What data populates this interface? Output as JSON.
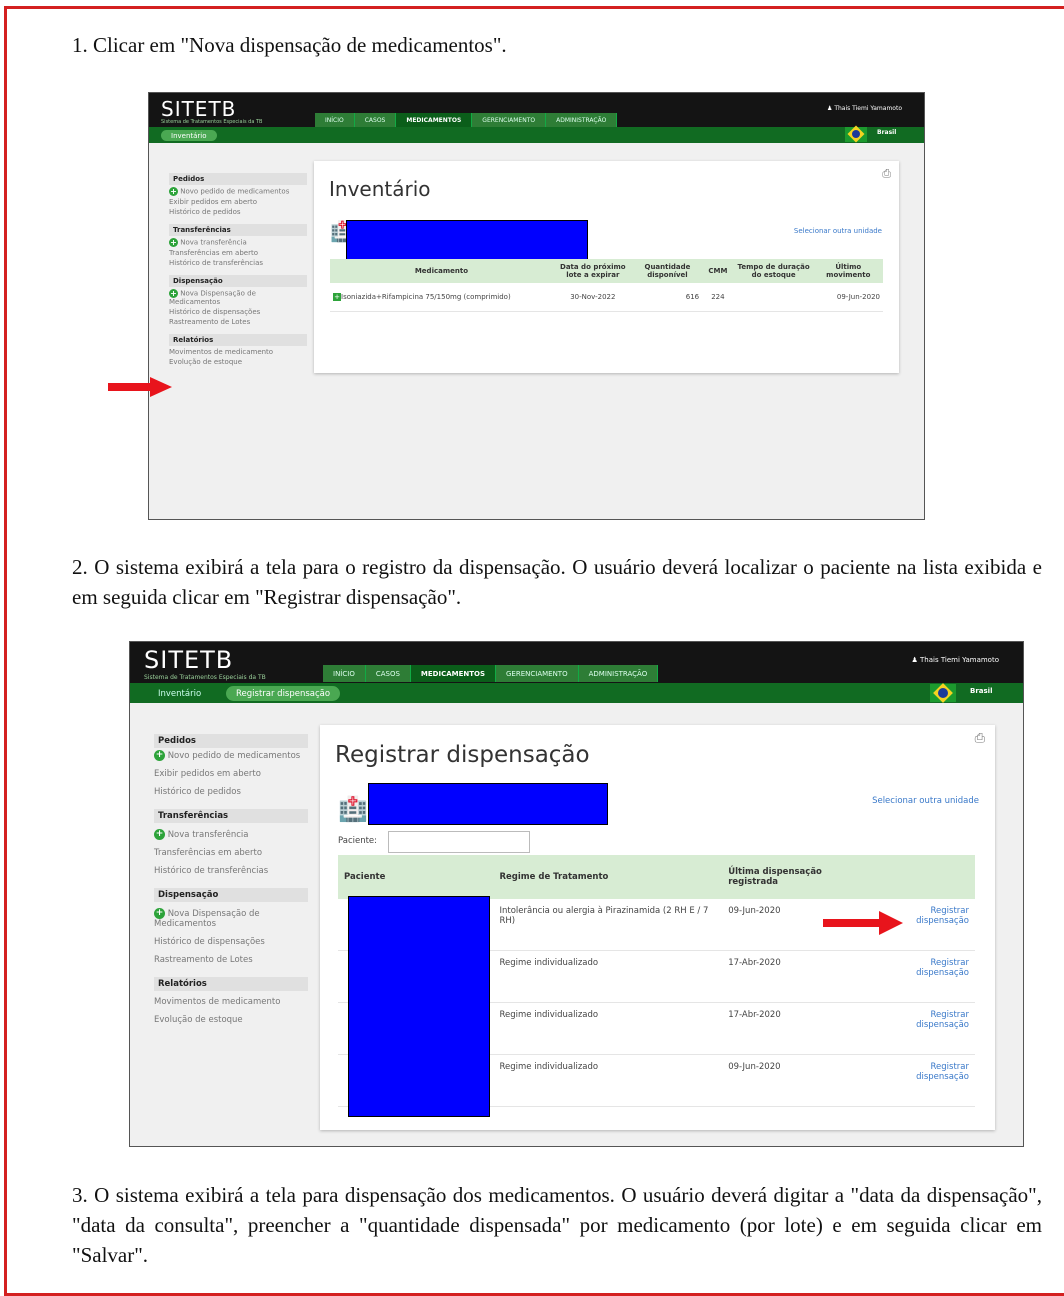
{
  "steps": {
    "step1": "1. Clicar em \"Nova dispensação de medicamentos\".",
    "step2": "2. O sistema exibirá a tela para o registro da dispensação. O usuário deverá localizar o paciente na lista exibida e em seguida clicar em \"Registrar dispensação\".",
    "step3": "3. O sistema exibirá a tela para dispensação dos medicamentos. O usuário deverá digitar a \"data da dispensação\", \"data da consulta\", preencher a \"quantidade dispensada\" por medicamento (por lote) e em seguida clicar em \"Salvar\"."
  },
  "colors": {
    "border": "#d42020",
    "brand_green": "#116b22",
    "redaction": "#0000ff",
    "arrow": "#e8141c",
    "link": "#3a79c9"
  },
  "app": {
    "logo": "SITETB",
    "logo_sub": "Sistema de Tratamentos Especiais da TB",
    "nav_tabs": [
      "INÍCIO",
      "CASOS",
      "MEDICAMENTOS",
      "GERENCIAMENTO",
      "ADMINISTRAÇÃO"
    ],
    "user": "Thais Tiemi Yamamoto",
    "country": "Brasil"
  },
  "sidebar": {
    "pedidos_head": "Pedidos",
    "novo_pedido": "Novo pedido de medicamentos",
    "exibir_pedidos": "Exibir pedidos em aberto",
    "historico_pedidos": "Histórico de pedidos",
    "transf_head": "Transferências",
    "nova_transf": "Nova transferência",
    "transf_aberto": "Transferências em aberto",
    "historico_transf": "Histórico de transferências",
    "disp_head": "Dispensação",
    "nova_disp": "Nova Dispensação de Medicamentos",
    "historico_disp": "Histórico de dispensações",
    "rastreamento": "Rastreamento de Lotes",
    "rel_head": "Relatórios",
    "movimentos": "Movimentos de medicamento",
    "evolucao": "Evolução de estoque"
  },
  "screen1": {
    "subtab": "Inventário",
    "title": "Inventário",
    "select_unit": "Selecionar outra unidade",
    "headers": [
      "Medicamento",
      "Data do próximo lote a expirar",
      "Quantidade disponível",
      "CMM",
      "Tempo de duração do estoque",
      "Último movimento"
    ],
    "row": [
      "Isoniazida+Rifampicina 75/150mg (comprimido)",
      "30-Nov-2022",
      "616",
      "224",
      "",
      "09-Jun-2020"
    ]
  },
  "screen2": {
    "subtab1": "Inventário",
    "subtab2": "Registrar dispensação",
    "title": "Registrar dispensação",
    "select_unit": "Selecionar outra unidade",
    "paciente_label": "Paciente:",
    "headers": [
      "Paciente",
      "Regime de Tratamento",
      "Última dispensação registrada",
      ""
    ],
    "rows": [
      {
        "regime": "Intolerância ou alergia à Pirazinamida (2 RH E / 7 RH)",
        "data": "09-Jun-2020",
        "link": "Registrar dispensação"
      },
      {
        "regime": "Regime individualizado",
        "data": "17-Abr-2020",
        "link": "Registrar dispensação"
      },
      {
        "regime": "Regime individualizado",
        "data": "17-Abr-2020",
        "link": "Registrar dispensação"
      },
      {
        "regime": "Regime individualizado",
        "data": "09-Jun-2020",
        "link": "Registrar dispensação"
      }
    ]
  }
}
